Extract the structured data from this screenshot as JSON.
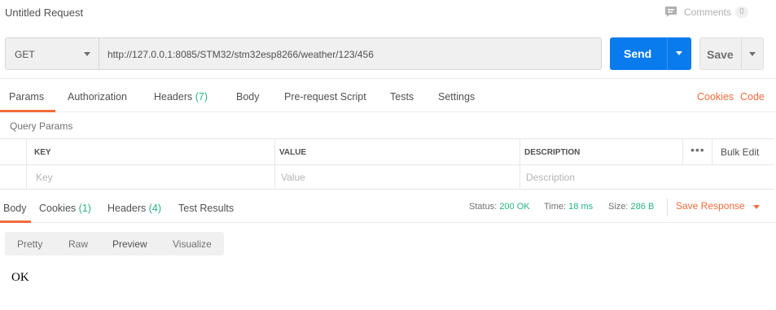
{
  "header": {
    "title": "Untitled Request",
    "comments_label": "Comments",
    "comments_count": "0"
  },
  "request": {
    "method": "GET",
    "url": "http://127.0.0.1:8085/STM32/stm32esp8266/weather/123/456",
    "send_label": "Send",
    "save_label": "Save"
  },
  "request_tabs": {
    "params": "Params",
    "authorization": "Authorization",
    "headers": "Headers",
    "headers_count": "(7)",
    "body": "Body",
    "prerequest": "Pre-request Script",
    "tests": "Tests",
    "settings": "Settings",
    "cookies": "Cookies",
    "code": "Code",
    "active": "Params"
  },
  "query_params": {
    "title": "Query Params",
    "columns": [
      "KEY",
      "VALUE",
      "DESCRIPTION"
    ],
    "bulk_edit": "Bulk Edit",
    "placeholders": [
      "Key",
      "Value",
      "Description"
    ]
  },
  "response_tabs": {
    "body": "Body",
    "cookies": "Cookies",
    "cookies_count": "(1)",
    "headers": "Headers",
    "headers_count": "(4)",
    "test_results": "Test Results",
    "active": "Body"
  },
  "status": {
    "status_label": "Status:",
    "status_value": "200 OK",
    "time_label": "Time:",
    "time_value": "18 ms",
    "size_label": "Size:",
    "size_value": "286 B",
    "save_response": "Save Response"
  },
  "view_tabs": {
    "pretty": "Pretty",
    "raw": "Raw",
    "preview": "Preview",
    "visualize": "Visualize",
    "active": "Preview"
  },
  "response_body": "OK",
  "colors": {
    "accent": "#f26b3a",
    "send_button": "#097bed",
    "count_green": "#26b47f"
  }
}
